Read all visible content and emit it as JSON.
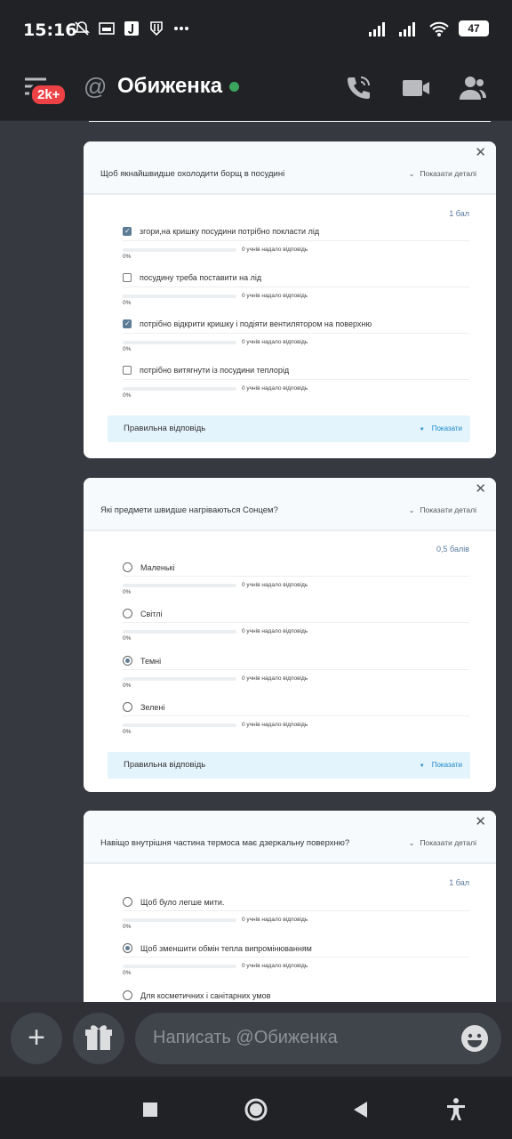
{
  "status_bar": {
    "time": "15:16",
    "battery": "47",
    "icons": [
      "bell-off-icon",
      "bed-icon",
      "j-icon",
      "shield-icon",
      "more-dots-icon"
    ]
  },
  "app_bar": {
    "badge": "2k+",
    "title": "Обиженка",
    "online_color": "#3ba55d",
    "icons": [
      "menu-icon",
      "at-icon",
      "phone-call-icon",
      "video-icon",
      "members-icon"
    ]
  },
  "cards": [
    {
      "question": "Щоб якнайшвидше охолодити борщ в посудині",
      "details_label": "Показати деталі",
      "score": "1 бал",
      "type": "checkbox",
      "options": [
        {
          "text": "згори,на кришку посудини потрібно покласти лід",
          "checked": true,
          "responses": "0 учнів надало відповідь",
          "percent": "0%"
        },
        {
          "text": "посудину треба поставити на лід",
          "checked": false,
          "responses": "0 учнів надало відповідь",
          "percent": "0%"
        },
        {
          "text": "потрібно відкрити кришку і подіяти вентилятором на поверхню",
          "checked": true,
          "responses": "0 учнів надало відповідь",
          "percent": "0%"
        },
        {
          "text": "потрібно витягнути із посудини теплорід",
          "checked": false,
          "responses": "0 учнів надало відповідь",
          "percent": "0%"
        }
      ],
      "answer_label": "Правильна відповідь",
      "show_label": "Показати"
    },
    {
      "question": "Які предмети швидше нагріваються Сонцем?",
      "details_label": "Показати деталі",
      "score": "0,5 балів",
      "type": "radio",
      "options": [
        {
          "text": "Маленькі",
          "checked": false,
          "responses": "0 учнів надало відповідь",
          "percent": "0%"
        },
        {
          "text": "Світлі",
          "checked": false,
          "responses": "0 учнів надало відповідь",
          "percent": "0%"
        },
        {
          "text": "Темні",
          "checked": true,
          "responses": "0 учнів надало відповідь",
          "percent": "0%"
        },
        {
          "text": "Зелені",
          "checked": false,
          "responses": "0 учнів надало відповідь",
          "percent": "0%"
        }
      ],
      "answer_label": "Правильна відповідь",
      "show_label": "Показати"
    },
    {
      "question": "Навіщо внутрішня частина термоса має дзеркальну поверхню?",
      "details_label": "Показати деталі",
      "score": "1 бал",
      "type": "radio",
      "options": [
        {
          "text": "Щоб було легше мити.",
          "checked": false,
          "responses": "0 учнів надало відповідь",
          "percent": "0%"
        },
        {
          "text": "Щоб зменшити обмін тепла випромінюванням",
          "checked": true,
          "responses": "0 учнів надало відповідь",
          "percent": "0%"
        },
        {
          "text": "Для косметичних і санітарних умов",
          "checked": false,
          "responses": "",
          "percent": ""
        }
      ]
    }
  ],
  "composer": {
    "placeholder": "Написать @Обиженка",
    "icons": [
      "plus-icon",
      "gift-icon",
      "emoji-icon"
    ]
  },
  "nav_bar": {
    "icons": [
      "recents-square-icon",
      "home-circle-icon",
      "back-triangle-icon",
      "accessibility-icon"
    ]
  }
}
